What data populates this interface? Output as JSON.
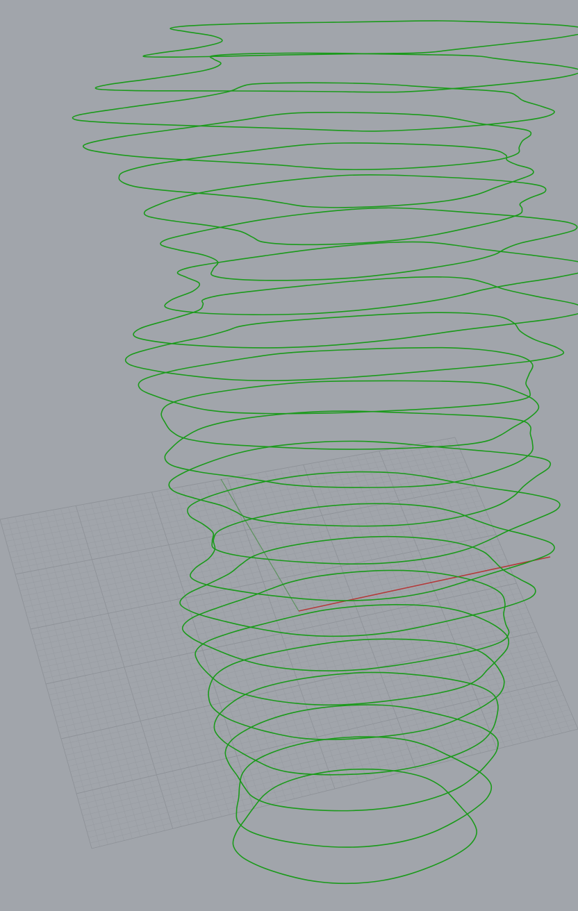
{
  "viewport": {
    "view": "perspective",
    "background_color": "#a1a5ab",
    "construction_grid": {
      "visible": true,
      "major_line_color": "#8e9298",
      "minor_line_color": "#989ca2"
    },
    "world_axes": {
      "x_axis_color": "#b33a3a",
      "y_axis_color": "#4f8f4f"
    },
    "curves": {
      "type": "closed-contour-curves",
      "count": 24,
      "color": "#1a9a1a"
    }
  }
}
